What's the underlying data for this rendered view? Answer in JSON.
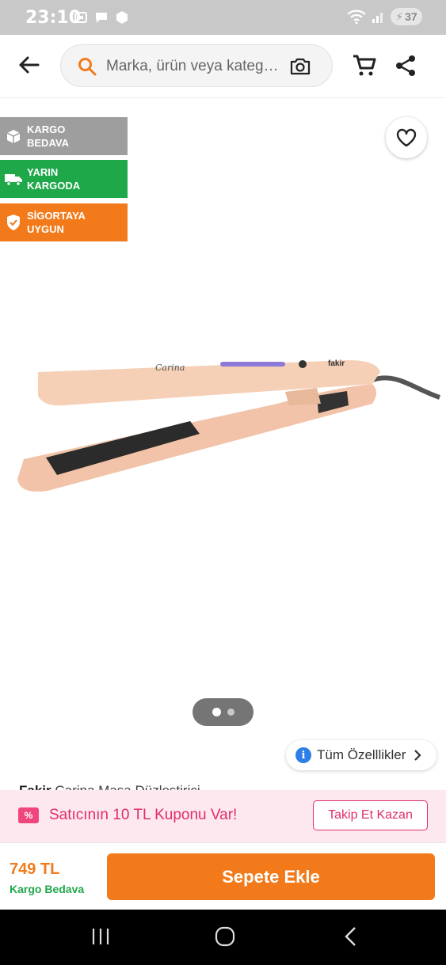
{
  "status_bar": {
    "time": "23:10",
    "battery": "37"
  },
  "header": {
    "search_placeholder": "Marka, ürün veya kategori ara",
    "icons": [
      "back-arrow-icon",
      "search-icon",
      "camera-icon",
      "cart-icon",
      "share-icon"
    ]
  },
  "badges": [
    {
      "line1": "KARGO",
      "line2": "BEDAVA",
      "icon": "box-icon",
      "color": "#9e9e9e"
    },
    {
      "line1": "YARIN",
      "line2": "KARGODA",
      "icon": "truck-icon",
      "color": "#1ea84a"
    },
    {
      "line1": "SİGORTAYA",
      "line2": "UYGUN",
      "icon": "shield-icon",
      "color": "#f27a1a"
    }
  ],
  "product": {
    "brand": "Fakir",
    "name": "Carina Maşa Düzleştirici",
    "image_marks": {
      "model": "Carina",
      "logo": "fakir"
    },
    "carousel": {
      "pages": 2,
      "current": 1
    }
  },
  "specs_button": {
    "label": "Tüm Özelllikler",
    "icon": "info-icon"
  },
  "coupon": {
    "icon_text": "%",
    "text": "Satıcının 10 TL Kuponu Var!",
    "button": "Takip Et Kazan"
  },
  "purchase": {
    "price": "749 TL",
    "shipping": "Kargo Bedava",
    "button": "Sepete Ekle"
  },
  "colors": {
    "primary": "#f27a1a",
    "green": "#1ea84a",
    "coupon_pink": "#e02d6b",
    "coupon_bg": "#fde8ef"
  },
  "nav": [
    "recent-apps-icon",
    "home-icon",
    "back-icon"
  ]
}
